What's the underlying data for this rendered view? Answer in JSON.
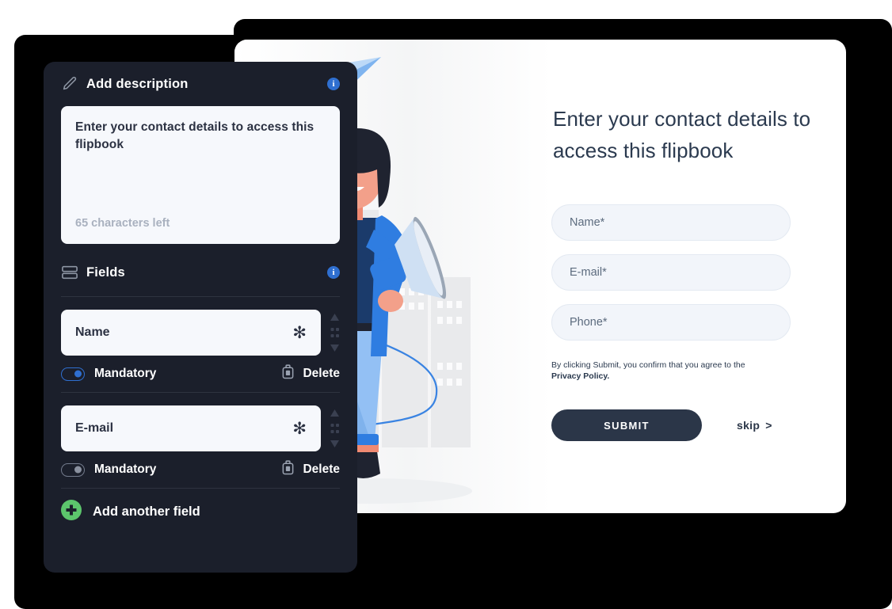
{
  "editor": {
    "description_section": {
      "icon": "pencil-icon",
      "title": "Add description",
      "info_icon": "info-icon",
      "info_glyph": "i",
      "value": "Enter your contact details to access this flipbook",
      "counter": "65 characters left"
    },
    "fields_section": {
      "icon": "fields-icon",
      "title": "Fields",
      "info_icon": "info-icon",
      "info_glyph": "i",
      "required_marker": "✻",
      "drag_handle_icon": "drag-handle-icon",
      "delete_icon": "trash-icon",
      "fields": [
        {
          "name": "Name",
          "mandatory_label": "Mandatory",
          "mandatory": true,
          "delete_label": "Delete"
        },
        {
          "name": "E-mail",
          "mandatory_label": "Mandatory",
          "mandatory": false,
          "delete_label": "Delete"
        }
      ],
      "add_field": {
        "icon": "plus-circle-icon",
        "label": "Add another field"
      }
    }
  },
  "preview": {
    "title": "Enter your contact details to access this flipbook",
    "fields": [
      {
        "placeholder": "Name*"
      },
      {
        "placeholder": "E-mail*"
      },
      {
        "placeholder": "Phone*"
      }
    ],
    "legal_prefix": "By clicking Submit, you confirm that you agree to the ",
    "legal_link": "Privacy Policy.",
    "submit_label": "SUBMIT",
    "skip_label": "skip",
    "skip_chevron": ">",
    "illustration": "woman-with-megaphone-illustration"
  },
  "colors": {
    "panel_bg": "#1b1f2b",
    "accent_blue": "#2f6fd0",
    "add_green": "#5cc56c",
    "submit_dark": "#2b3648",
    "input_bg": "#f2f5fa",
    "title_color": "#2b3a4f"
  }
}
